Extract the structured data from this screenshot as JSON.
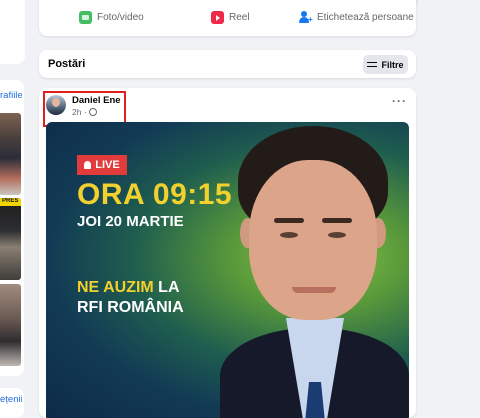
{
  "left_sidebar": {
    "link_top": "rafiile",
    "thumb_label": "PRES",
    "link_bottom": "ețenii"
  },
  "composer": {
    "actions": [
      {
        "label": "Foto/video",
        "icon": "photo-icon"
      },
      {
        "label": "Reel",
        "icon": "reel-icon"
      },
      {
        "label": "Etichetează persoane",
        "icon": "tag-people-icon"
      }
    ]
  },
  "posts_header": {
    "title": "Postări",
    "filter_label": "Filtre",
    "filter_icon": "filter-sliders-icon"
  },
  "post": {
    "author": "Daniel Ene",
    "time": "2h ·",
    "privacy_icon": "globe-icon",
    "more_label": "···",
    "highlight_color": "#e0201f",
    "image": {
      "live_label": "LIVE",
      "time_text": "ORA 09:15",
      "date_text": "JOI 20 MARTIE",
      "line1_yellow": "NE AUZIM",
      "line1_white": " LA",
      "line2": "RFI ROMÂNIA",
      "accent_yellow": "#f2d12e",
      "accent_red": "#e23b3b"
    }
  },
  "colors": {
    "page_bg": "#f0f2f5",
    "card_bg": "#ffffff",
    "link_blue": "#216fdb",
    "secondary_text": "#65676b"
  }
}
